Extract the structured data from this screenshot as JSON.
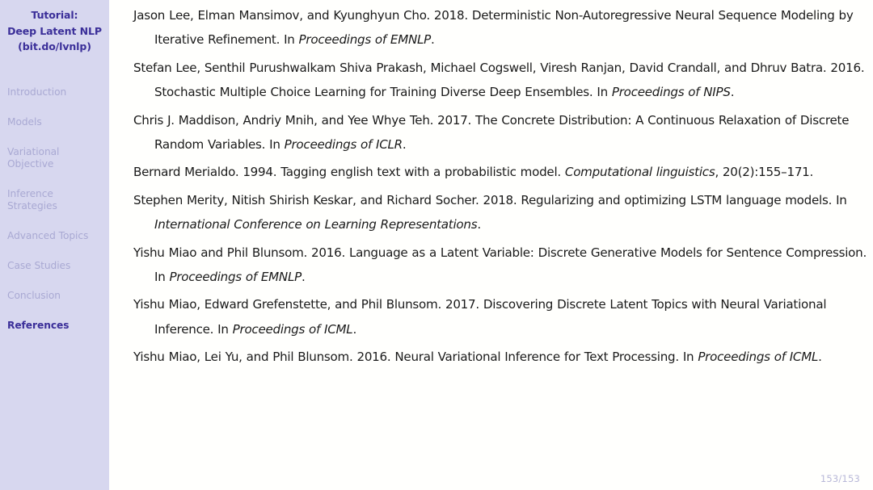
{
  "sidebar": {
    "title_lines": [
      "Tutorial:",
      "Deep Latent NLP",
      "(bit.do/lvnlp)"
    ],
    "items": [
      {
        "lines": [
          "Introduction"
        ],
        "current": false
      },
      {
        "lines": [
          "Models"
        ],
        "current": false
      },
      {
        "lines": [
          "Variational",
          "Objective"
        ],
        "current": false
      },
      {
        "lines": [
          "Inference",
          "Strategies"
        ],
        "current": false
      },
      {
        "lines": [
          "Advanced Topics"
        ],
        "current": false
      },
      {
        "lines": [
          "Case Studies"
        ],
        "current": false
      },
      {
        "lines": [
          "Conclusion"
        ],
        "current": false
      },
      {
        "lines": [
          "References"
        ],
        "current": true
      }
    ],
    "colors": {
      "background": "#d7d7ef",
      "active_text": "#3b2f99",
      "inactive_text": "#a9a9d3"
    }
  },
  "content": {
    "background": "#fffffd",
    "text_color": "#1a1a1a",
    "references": [
      {
        "id": "lee-2018-deterministic",
        "html": "Jason Lee, Elman Mansimov, and Kyunghyun Cho. 2018. Deterministic Non-Autoregressive Neural Sequence Modeling by Iterative Refinement. In <em>Proceedings of EMNLP</em>.",
        "authors": "Jason Lee, Elman Mansimov, and Kyunghyun Cho",
        "year": "2018",
        "title": "Deterministic Non-Autoregressive Neural Sequence Modeling by Iterative Refinement",
        "venue": "Proceedings of EMNLP"
      },
      {
        "id": "lee-2016-stochastic",
        "html": "Stefan Lee, Senthil Purushwalkam Shiva Prakash, Michael Cogswell, Viresh Ranjan, David Crandall, and Dhruv Batra. 2016. Stochastic Multiple Choice Learning for Training Diverse Deep Ensembles. In <em>Proceedings of NIPS</em>.",
        "authors": "Stefan Lee, Senthil Purushwalkam Shiva Prakash, Michael Cogswell, Viresh Ranjan, David Crandall, and Dhruv Batra",
        "year": "2016",
        "title": "Stochastic Multiple Choice Learning for Training Diverse Deep Ensembles",
        "venue": "Proceedings of NIPS"
      },
      {
        "id": "maddison-2017-concrete",
        "html": "Chris J. Maddison, Andriy Mnih, and Yee Whye Teh. 2017. The Concrete Distribution: A Continuous Relaxation of Discrete Random Variables. In <em>Proceedings of ICLR</em>.",
        "authors": "Chris J. Maddison, Andriy Mnih, and Yee Whye Teh",
        "year": "2017",
        "title": "The Concrete Distribution: A Continuous Relaxation of Discrete Random Variables",
        "venue": "Proceedings of ICLR"
      },
      {
        "id": "merialdo-1994-tagging",
        "html": "Bernard Merialdo. 1994. Tagging english text with a probabilistic model. <em>Computational linguistics</em>, 20(2):155–171.",
        "authors": "Bernard Merialdo",
        "year": "1994",
        "title": "Tagging english text with a probabilistic model",
        "venue": "Computational linguistics, 20(2):155–171"
      },
      {
        "id": "merity-2018-regularizing",
        "html": "Stephen Merity, Nitish Shirish Keskar, and Richard Socher. 2018. Regularizing and optimizing LSTM language models. In <em>International Conference on Learning Representations</em>.",
        "authors": "Stephen Merity, Nitish Shirish Keskar, and Richard Socher",
        "year": "2018",
        "title": "Regularizing and optimizing LSTM language models",
        "venue": "International Conference on Learning Representations"
      },
      {
        "id": "miao-2016-language",
        "html": "Yishu Miao and Phil Blunsom. 2016. Language as a Latent Variable: Discrete Generative Models for Sentence Compression. In <em>Proceedings of EMNLP</em>.",
        "authors": "Yishu Miao and Phil Blunsom",
        "year": "2016",
        "title": "Language as a Latent Variable: Discrete Generative Models for Sentence Compression",
        "venue": "Proceedings of EMNLP"
      },
      {
        "id": "miao-2017-discovering",
        "html": "Yishu Miao, Edward Grefenstette, and Phil Blunsom. 2017. Discovering Discrete Latent Topics with Neural Variational Inference. In <em>Proceedings of ICML</em>.",
        "authors": "Yishu Miao, Edward Grefenstette, and Phil Blunsom",
        "year": "2017",
        "title": "Discovering Discrete Latent Topics with Neural Variational Inference",
        "venue": "Proceedings of ICML"
      },
      {
        "id": "miao-2016-neural",
        "html": "Yishu Miao, Lei Yu, and Phil Blunsom. 2016. Neural Variational Inference for Text Processing. In <em>Proceedings of ICML</em>.",
        "authors": "Yishu Miao, Lei Yu, and Phil Blunsom",
        "year": "2016",
        "title": "Neural Variational Inference for Text Processing",
        "venue": "Proceedings of ICML"
      }
    ]
  },
  "footer": {
    "page_number": "153/153",
    "current_page": 153,
    "total_pages": 153
  }
}
